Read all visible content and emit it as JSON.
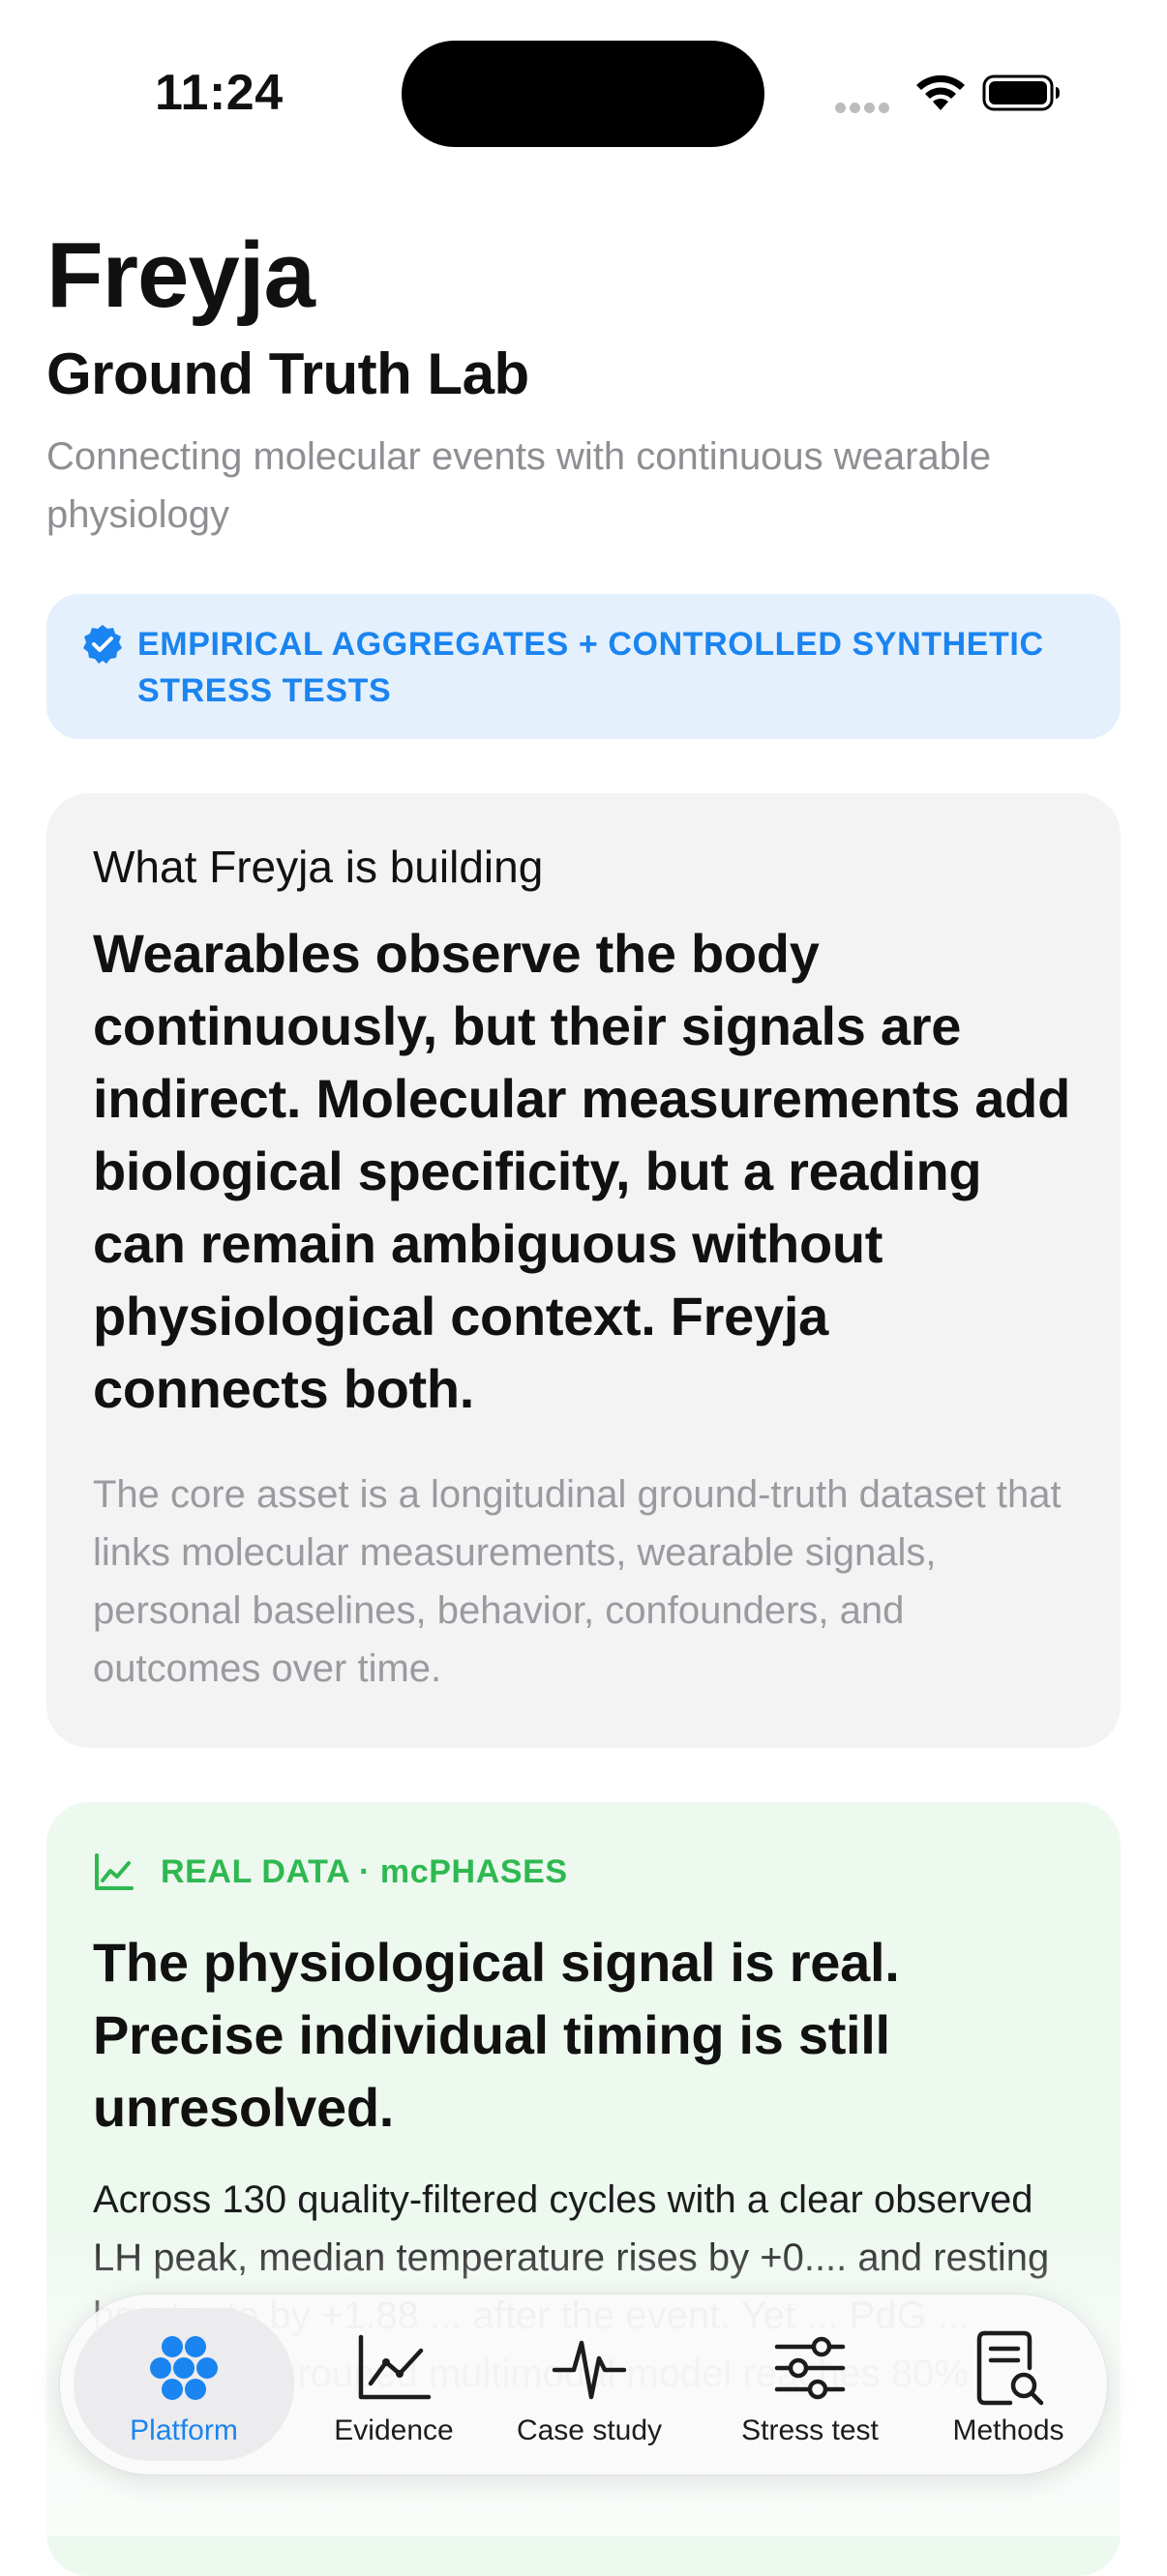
{
  "status_bar": {
    "time": "11:24"
  },
  "header": {
    "title": "Freyja",
    "subtitle": "Ground Truth Lab",
    "tagline": "Connecting molecular events with continuous wearable physiology"
  },
  "banner": {
    "icon": "verified-badge-icon",
    "text": "EMPIRICAL AGGREGATES + CONTROLLED SYNTHETIC STRESS TESTS",
    "color": "#1a84f0"
  },
  "building_card": {
    "kicker": "What Freyja is building",
    "headline": "Wearables observe the body continuously, but their signals are indirect. Molecular measurements add biological specificity, but a reading can remain ambiguous without physiological context. Freyja connects both.",
    "body": "The core asset is a longitudinal ground-truth dataset that links molecular measurements, wearable signals, personal baselines, behavior, confounders, and outcomes over time."
  },
  "real_data_card": {
    "icon": "line-chart-icon",
    "kicker": "REAL DATA · mcPHASES",
    "kicker_color": "#2fb851",
    "headline": "The physiological signal is real. Precise individual timing is still unresolved.",
    "body": "Across 130 quality-filtered cycles with a clear observed LH peak, median temperature rises by +0.... and resting heart rate by +1.88 ... after the event. Yet ... PdG ... support ... grouped multimodal model reaches 80%"
  },
  "tab_bar": {
    "active_color": "#1a84f0",
    "tabs": [
      {
        "label": "Platform",
        "icon": "platform-dots-icon",
        "active": true
      },
      {
        "label": "Evidence",
        "icon": "chart-icon",
        "active": false
      },
      {
        "label": "Case study",
        "icon": "waveform-icon",
        "active": false
      },
      {
        "label": "Stress test",
        "icon": "sliders-icon",
        "active": false
      },
      {
        "label": "Methods",
        "icon": "document-search-icon",
        "active": false
      }
    ]
  }
}
